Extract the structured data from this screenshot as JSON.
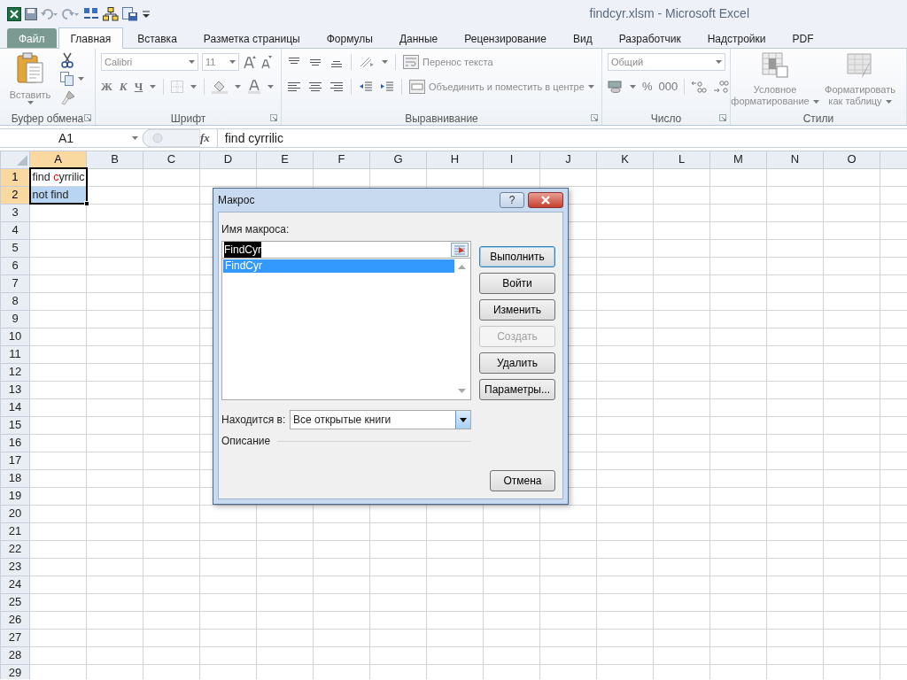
{
  "window": {
    "title": "findcyr.xlsm  -  Microsoft Excel"
  },
  "ribbon_tabs": [
    {
      "label": "Файл",
      "kind": "file",
      "selected": false
    },
    {
      "label": "Главная",
      "kind": "tab",
      "selected": true
    },
    {
      "label": "Вставка",
      "kind": "tab",
      "selected": false
    },
    {
      "label": "Разметка страницы",
      "kind": "tab",
      "selected": false
    },
    {
      "label": "Формулы",
      "kind": "tab",
      "selected": false
    },
    {
      "label": "Данные",
      "kind": "tab",
      "selected": false
    },
    {
      "label": "Рецензирование",
      "kind": "tab",
      "selected": false
    },
    {
      "label": "Вид",
      "kind": "tab",
      "selected": false
    },
    {
      "label": "Разработчик",
      "kind": "tab",
      "selected": false
    },
    {
      "label": "Надстройки",
      "kind": "tab",
      "selected": false
    },
    {
      "label": "PDF",
      "kind": "tab",
      "selected": false
    }
  ],
  "ribbon": {
    "disabled": true,
    "clipboard": {
      "title": "Буфер обмена",
      "paste_label": "Вставить"
    },
    "font": {
      "title": "Шрифт",
      "font_name": "Calibri",
      "font_size": "11",
      "bold": "Ж",
      "italic": "К",
      "underline": "Ч"
    },
    "alignment": {
      "title": "Выравнивание",
      "wrap_text": "Перенос текста",
      "merge_center": "Объединить и поместить в центре"
    },
    "number": {
      "title": "Число",
      "format": "Общий",
      "percent": "%",
      "thousands": "000"
    },
    "styles": {
      "title": "Стили",
      "conditional": [
        "Условное",
        "форматирование"
      ],
      "format_table": [
        "Форматировать",
        "как таблицу"
      ]
    }
  },
  "formula_bar": {
    "name_box": "A1",
    "fx_label": "fx",
    "formula": "find cyrrilic"
  },
  "sheet": {
    "columns": [
      {
        "label": "A",
        "selected": true
      },
      {
        "label": "B",
        "selected": false
      },
      {
        "label": "C",
        "selected": false
      },
      {
        "label": "D",
        "selected": false
      },
      {
        "label": "E",
        "selected": false
      },
      {
        "label": "F",
        "selected": false
      },
      {
        "label": "G",
        "selected": false
      },
      {
        "label": "H",
        "selected": false
      },
      {
        "label": "I",
        "selected": false
      },
      {
        "label": "J",
        "selected": false
      },
      {
        "label": "K",
        "selected": false
      },
      {
        "label": "L",
        "selected": false
      },
      {
        "label": "M",
        "selected": false
      },
      {
        "label": "N",
        "selected": false
      },
      {
        "label": "O",
        "selected": false
      }
    ],
    "rows": [
      {
        "label": "1",
        "selected": true,
        "cells": [
          {
            "highlighted": false,
            "segments": [
              {
                "text": "find "
              },
              {
                "text": "c",
                "color": "#ff0000"
              },
              {
                "text": "yrrilic"
              }
            ]
          }
        ]
      },
      {
        "label": "2",
        "selected": true,
        "cells": [
          {
            "highlighted": true,
            "segments": [
              {
                "text": "not find"
              }
            ]
          }
        ]
      },
      {
        "label": "3",
        "selected": false
      },
      {
        "label": "4",
        "selected": false
      },
      {
        "label": "5",
        "selected": false
      },
      {
        "label": "6",
        "selected": false
      },
      {
        "label": "7",
        "selected": false
      },
      {
        "label": "8",
        "selected": false
      },
      {
        "label": "9",
        "selected": false
      },
      {
        "label": "10",
        "selected": false
      },
      {
        "label": "11",
        "selected": false
      },
      {
        "label": "12",
        "selected": false
      },
      {
        "label": "13",
        "selected": false
      },
      {
        "label": "14",
        "selected": false
      },
      {
        "label": "15",
        "selected": false
      },
      {
        "label": "16",
        "selected": false
      },
      {
        "label": "17",
        "selected": false
      },
      {
        "label": "18",
        "selected": false
      },
      {
        "label": "19",
        "selected": false
      },
      {
        "label": "20",
        "selected": false
      },
      {
        "label": "21",
        "selected": false
      },
      {
        "label": "22",
        "selected": false
      },
      {
        "label": "23",
        "selected": false
      },
      {
        "label": "24",
        "selected": false
      },
      {
        "label": "25",
        "selected": false
      },
      {
        "label": "26",
        "selected": false
      },
      {
        "label": "27",
        "selected": false
      },
      {
        "label": "28",
        "selected": false
      },
      {
        "label": "29",
        "selected": false
      }
    ]
  },
  "dialog": {
    "title": "Макрос",
    "help_glyph": "?",
    "name_label": "Имя макроса:",
    "name_value": "FindCyr",
    "name_selected": true,
    "macros": [
      {
        "label": "FindCyr",
        "selected": true
      }
    ],
    "buttons": [
      {
        "label": "Выполнить",
        "kind": "default",
        "disabled": false
      },
      {
        "label": "Войти",
        "kind": "normal",
        "disabled": false
      },
      {
        "label": "Изменить",
        "kind": "normal",
        "disabled": false
      },
      {
        "label": "Создать",
        "kind": "normal",
        "disabled": true
      },
      {
        "label": "Удалить",
        "kind": "normal",
        "disabled": false
      },
      {
        "label": "Параметры...",
        "kind": "normal",
        "disabled": false
      }
    ],
    "location_label": "Находится в:",
    "location_value": "Все открытые книги",
    "description_label": "Описание",
    "cancel": "Отмена"
  }
}
